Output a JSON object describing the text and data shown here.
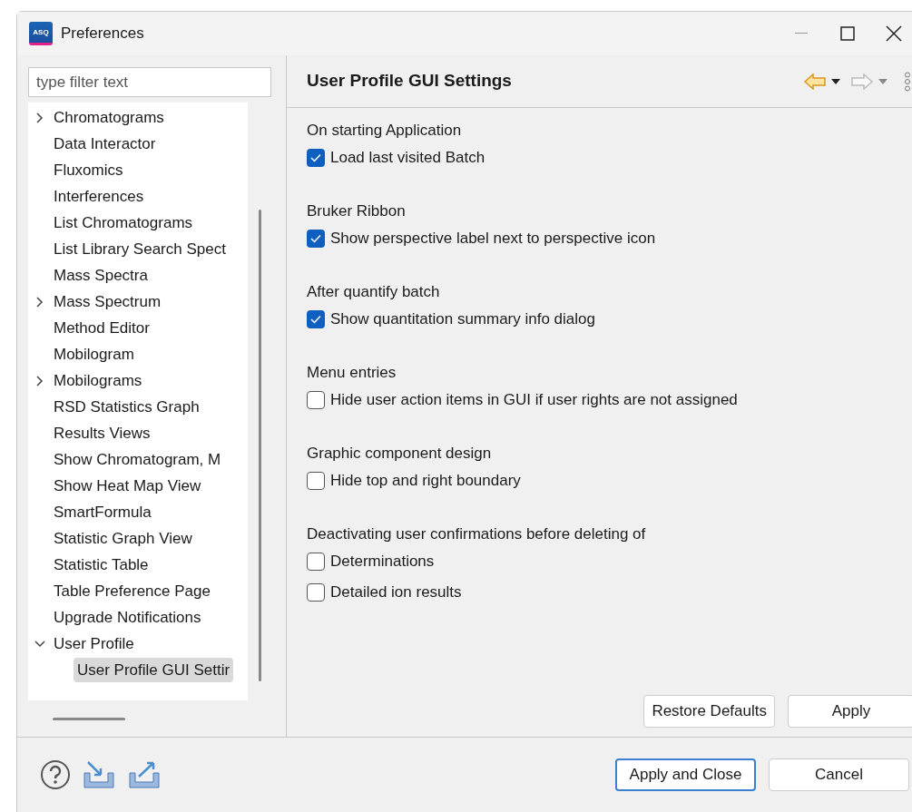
{
  "window": {
    "title": "Preferences",
    "logo": "ASQ"
  },
  "filter": {
    "placeholder": "type filter text"
  },
  "tree": [
    {
      "label": "Chromatograms",
      "expanded": false,
      "selected": false
    },
    {
      "label": "Data Interactor",
      "selected": false
    },
    {
      "label": "Fluxomics",
      "selected": false
    },
    {
      "label": "Interferences",
      "selected": false
    },
    {
      "label": "List Chromatograms",
      "selected": false
    },
    {
      "label": "List Library Search Spect",
      "selected": false
    },
    {
      "label": "Mass Spectra",
      "selected": false
    },
    {
      "label": "Mass Spectrum",
      "expanded": false,
      "selected": false
    },
    {
      "label": "Method Editor",
      "selected": false
    },
    {
      "label": "Mobilogram",
      "selected": false
    },
    {
      "label": "Mobilograms",
      "expanded": false,
      "selected": false
    },
    {
      "label": "RSD Statistics Graph",
      "selected": false
    },
    {
      "label": "Results Views",
      "selected": false
    },
    {
      "label": "Show Chromatogram, M",
      "selected": false
    },
    {
      "label": "Show Heat Map View",
      "selected": false
    },
    {
      "label": "SmartFormula",
      "selected": false
    },
    {
      "label": "Statistic Graph View",
      "selected": false
    },
    {
      "label": "Statistic Table",
      "selected": false
    },
    {
      "label": "Table Preference Page",
      "selected": false
    },
    {
      "label": "Upgrade Notifications",
      "selected": false
    },
    {
      "label": "User Profile",
      "expanded": true,
      "selected": false,
      "children": [
        {
          "label": "User Profile GUI Settir",
          "selected": true
        }
      ]
    }
  ],
  "page": {
    "title": "User Profile GUI Settings",
    "sections": [
      {
        "heading": "On starting Application",
        "options": [
          {
            "label": "Load last visited Batch",
            "checked": true
          }
        ]
      },
      {
        "heading": "Bruker Ribbon",
        "options": [
          {
            "label": "Show perspective label next to perspective icon",
            "checked": true
          }
        ]
      },
      {
        "heading": "After quantify batch",
        "options": [
          {
            "label": "Show quantitation summary info dialog",
            "checked": true
          }
        ]
      },
      {
        "heading": "Menu entries",
        "options": [
          {
            "label": "Hide user action items in GUI if user rights are not assigned",
            "checked": false
          }
        ]
      },
      {
        "heading": "Graphic component design",
        "options": [
          {
            "label": "Hide top and right boundary",
            "checked": false
          }
        ]
      },
      {
        "heading": "Deactivating user confirmations before deleting of",
        "options": [
          {
            "label": "Determinations",
            "checked": false
          },
          {
            "label": "Detailed ion results",
            "checked": false
          }
        ]
      }
    ],
    "buttons": [
      "Restore Defaults",
      "Apply"
    ]
  },
  "footer_buttons": [
    {
      "label": "Apply and Close",
      "default": true
    },
    {
      "label": "Cancel",
      "default": false
    }
  ]
}
